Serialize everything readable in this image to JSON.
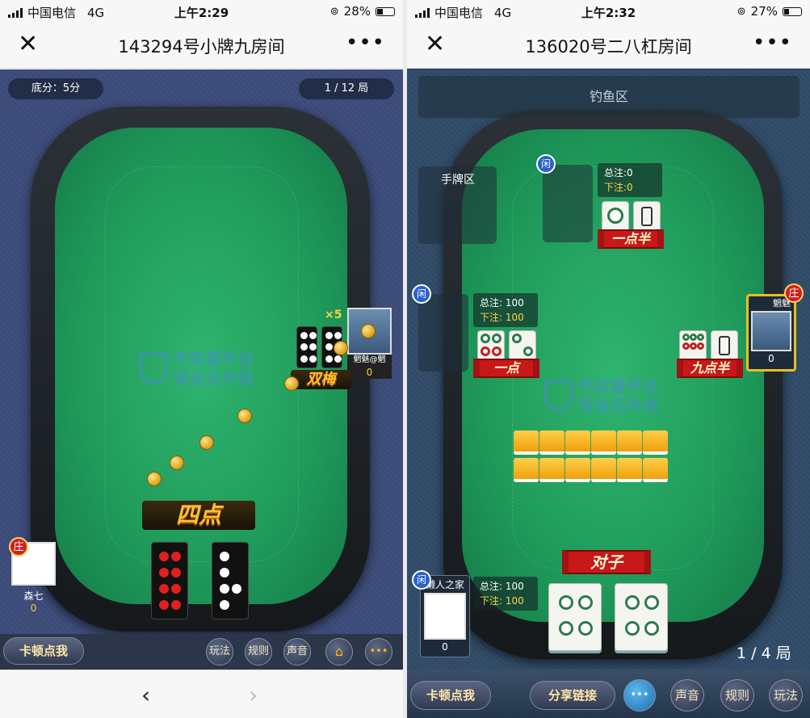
{
  "left": {
    "status": {
      "carrier": "中国电信",
      "network": "4G",
      "time": "上午2:29",
      "battery": "28%"
    },
    "nav": {
      "close_icon": "close-icon",
      "title": "143294号小牌九房间",
      "more_icon": "more-icon"
    },
    "top": {
      "base_score": "底分：5分",
      "round": "1 / 12 局"
    },
    "watermark": {
      "line1": "牛欢喜平台",
      "line2": "安全无外挂"
    },
    "opponent": {
      "name": "魍魅@魍",
      "score": "0",
      "multiplier": "×5",
      "hand_label": "双梅"
    },
    "self": {
      "banker_badge": "庄",
      "name": "森七",
      "score": "0",
      "hand_label": "四点"
    },
    "bottom": {
      "lag": "卡顿点我",
      "play": "玩法",
      "rules": "规则",
      "sound": "声音",
      "home_icon": "home-icon",
      "chat_icon": "chat-icon"
    },
    "browser": {
      "back_icon": "back-icon",
      "forward_icon": "forward-icon"
    }
  },
  "right": {
    "status": {
      "carrier": "中国电信",
      "network": "4G",
      "time": "上午2:32",
      "battery": "27%"
    },
    "nav": {
      "close_icon": "close-icon",
      "title": "136020号二八杠房间",
      "more_icon": "more-icon"
    },
    "fishing": "钓鱼区",
    "hand_area": "手牌区",
    "xian_badge": "闲",
    "zhuang_badge": "庄",
    "watermark": {
      "line1": "牛欢喜平台",
      "line2": "安全无外挂"
    },
    "top_player": {
      "total": "总注:0",
      "bet": "下注:0",
      "hand_label": "一点半"
    },
    "left_player": {
      "total": "总注: 100",
      "bet": "下注: 100",
      "hand_label": "一点"
    },
    "right_player": {
      "name": "魍魅",
      "score": "0",
      "hand_label": "九点半"
    },
    "self": {
      "name": "懒人之家",
      "score": "0",
      "total": "总注: 100",
      "bet": "下注: 100",
      "hand_label": "对子"
    },
    "round": "1 / 4 局",
    "bottom": {
      "lag": "卡顿点我",
      "share": "分享链接",
      "chat_icon": "chat-icon",
      "sound": "声音",
      "rules": "规则",
      "play": "玩法"
    }
  }
}
